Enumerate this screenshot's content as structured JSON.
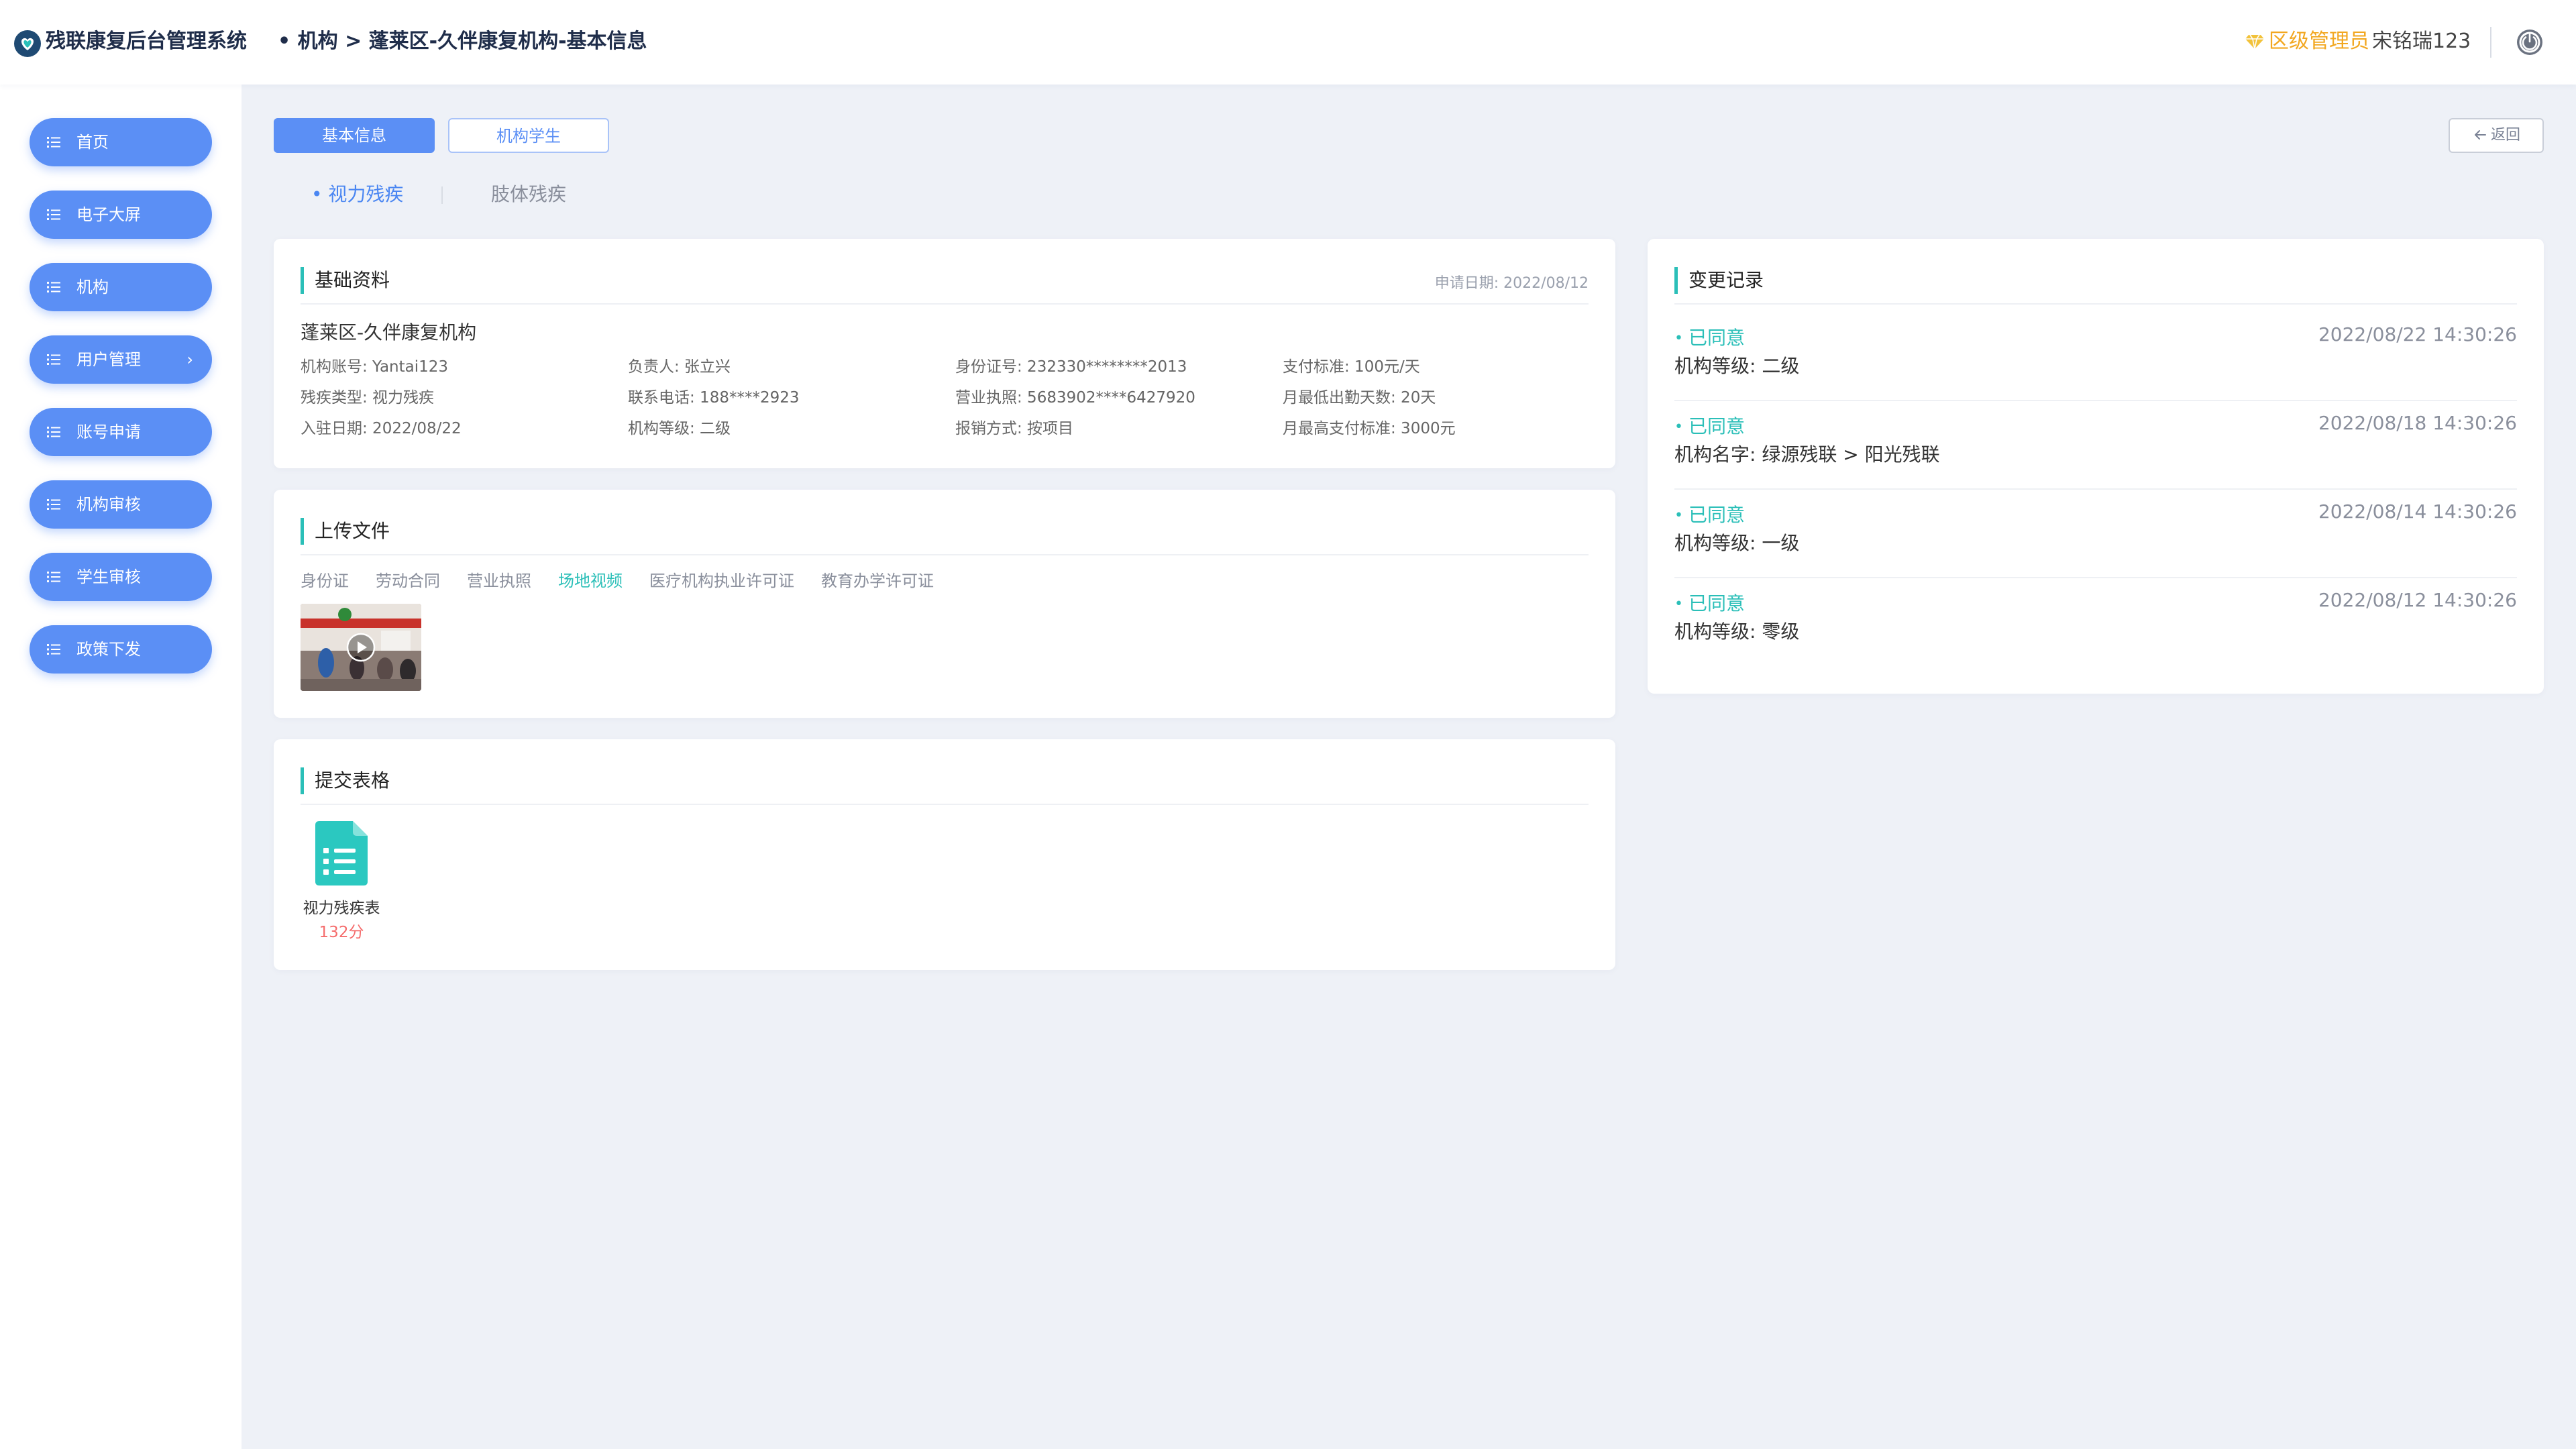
{
  "app": {
    "title": "残联康复后台管理系统",
    "breadcrumb": "• 机构 > 蓬莱区-久伴康复机构-基本信息",
    "role": "区级管理员",
    "username": "宋铭瑞123"
  },
  "sidebar": {
    "items": [
      {
        "label": "首页"
      },
      {
        "label": "电子大屏"
      },
      {
        "label": "机构"
      },
      {
        "label": "用户管理",
        "chevron": "›"
      },
      {
        "label": "账号申请"
      },
      {
        "label": "机构审核"
      },
      {
        "label": "学生审核"
      },
      {
        "label": "政策下发"
      }
    ]
  },
  "tabs": {
    "basic": "基本信息",
    "students": "机构学生",
    "back": "返回"
  },
  "subtabs": {
    "visual": "• 视力残疾",
    "physical": "肢体残疾"
  },
  "basic_card": {
    "title": "基础资料",
    "apply_date": "申请日期: 2022/08/12",
    "org_name": "蓬莱区-久伴康复机构",
    "fields": [
      "机构账号:  Yantai123",
      "负责人:     张立兴",
      "身份证号:  232330********2013",
      "支付标准:  100元/天",
      "残疾类型:  视力残疾",
      "联系电话:  188****2923",
      "营业执照:  5683902****6427920",
      "月最低出勤天数:  20天",
      "入驻日期:  2022/08/22",
      "机构等级:  二级",
      "报销方式:  按项目",
      "月最高支付标准:  3000元"
    ]
  },
  "upload_card": {
    "title": "上传文件",
    "tabs": [
      "身份证",
      "劳动合同",
      "营业执照",
      "场地视频",
      "医疗机构执业许可证",
      "教育办学许可证"
    ],
    "active_tab": 3
  },
  "form_card": {
    "title": "提交表格",
    "form_name": "视力残疾表",
    "score": "132分"
  },
  "log_card": {
    "title": "变更记录",
    "items": [
      {
        "status": "已同意",
        "time": "2022/08/22 14:30:26",
        "detail": "机构等级: 二级"
      },
      {
        "status": "已同意",
        "time": "2022/08/18 14:30:26",
        "detail": "机构名字: 绿源残联 > 阳光残联"
      },
      {
        "status": "已同意",
        "time": "2022/08/14 14:30:26",
        "detail": "机构等级: 一级"
      },
      {
        "status": "已同意",
        "time": "2022/08/12 14:30:26",
        "detail": "机构等级: 零级"
      }
    ]
  },
  "colors": {
    "primary": "#5b8ff5",
    "teal": "#2bbfb8",
    "gold": "#f2a720",
    "score_red": "#f56c6c",
    "page_bg": "#eef1f7"
  },
  "icons": {
    "logo": "heart-logo-icon",
    "role": "diamond-icon",
    "power": "power-icon",
    "nav": "list-icon",
    "back": "arrow-left-icon",
    "video": "play-icon",
    "form": "document-list-icon"
  }
}
